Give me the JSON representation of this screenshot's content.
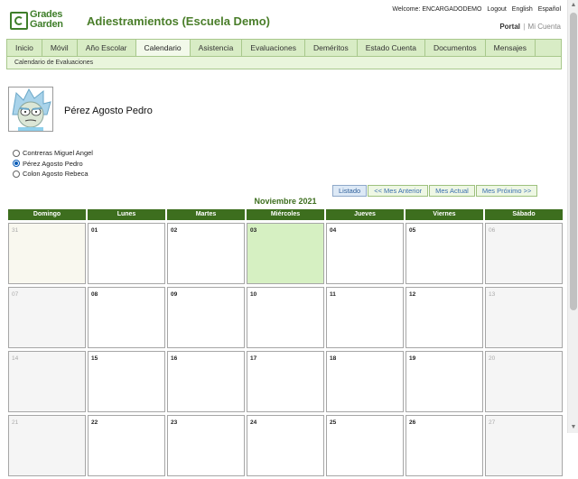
{
  "header": {
    "logo_line1": "Grades",
    "logo_line2": "Garden",
    "app_title": "Adiestramientos (Escuela Demo)",
    "welcome": "Welcome: ENCARGADODEMO",
    "logout": "Logout",
    "english": "English",
    "espanol": "Español",
    "portal": "Portal",
    "portal_sep": "|",
    "mi_cuenta": "Mi Cuenta"
  },
  "nav": {
    "tabs": [
      {
        "label": "Inicio"
      },
      {
        "label": "Móvil"
      },
      {
        "label": "Año Escolar"
      },
      {
        "label": "Calendario",
        "active": true
      },
      {
        "label": "Asistencia"
      },
      {
        "label": "Evaluaciones"
      },
      {
        "label": "Deméritos"
      },
      {
        "label": "Estado Cuenta"
      },
      {
        "label": "Documentos"
      },
      {
        "label": "Mensajes"
      }
    ],
    "subnav": "Calendario de Evaluaciones"
  },
  "student": {
    "name": "Pérez Agosto Pedro"
  },
  "students": [
    {
      "label": "Contreras Miguel Angel",
      "selected": false
    },
    {
      "label": "Pérez Agosto Pedro",
      "selected": true
    },
    {
      "label": "Colon Agosto Rebeca",
      "selected": false
    }
  ],
  "calendar": {
    "buttons": {
      "listado": "Listado",
      "prev": "<< Mes Anterior",
      "current": "Mes Actual",
      "next": "Mes Próximo >>"
    },
    "month_title": "Noviembre 2021",
    "day_names": [
      "Domingo",
      "Lunes",
      "Martes",
      "Miércoles",
      "Jueves",
      "Viernes",
      "Sábado"
    ],
    "weeks": [
      [
        "31",
        "01",
        "02",
        "03",
        "04",
        "05",
        "06"
      ],
      [
        "07",
        "08",
        "09",
        "10",
        "11",
        "12",
        "13"
      ],
      [
        "14",
        "15",
        "16",
        "17",
        "18",
        "19",
        "20"
      ],
      [
        "21",
        "22",
        "23",
        "24",
        "25",
        "26",
        "27"
      ]
    ],
    "today": "03"
  },
  "colors": {
    "accent": "#3d6e1e",
    "today_fill": "#d6f0c2",
    "nav_bg": "#d8ecc5"
  }
}
